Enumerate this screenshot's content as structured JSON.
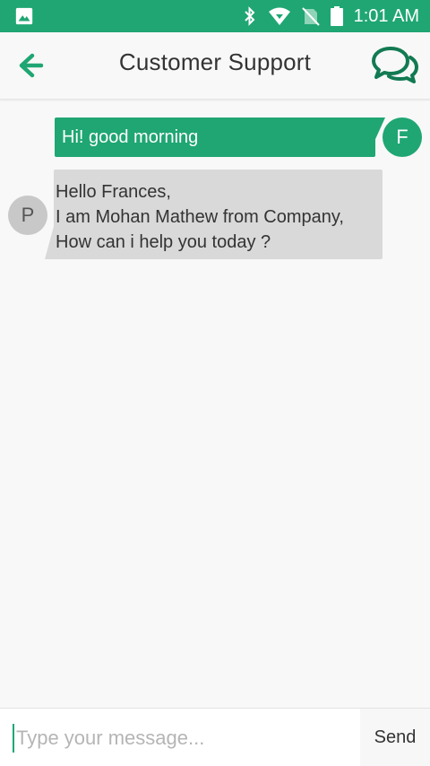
{
  "status_bar": {
    "time": "1:01 AM",
    "icons": [
      "image-icon",
      "bluetooth-icon",
      "wifi-icon",
      "no-sim-icon",
      "battery-icon"
    ]
  },
  "header": {
    "title": "Customer Support",
    "back_icon": "arrow-left-icon",
    "chat_icon": "chat-bubbles-icon",
    "accent_color": "#1fa673"
  },
  "messages": [
    {
      "side": "sent",
      "avatar_letter": "F",
      "text": "Hi! good morning"
    },
    {
      "side": "received",
      "avatar_letter": "P",
      "lines": [
        "Hello Frances,",
        "I am Mohan Mathew from Company,",
        "How can i help you today ?"
      ]
    }
  ],
  "composer": {
    "placeholder": "Type your message...",
    "value": "",
    "send_label": "Send"
  }
}
